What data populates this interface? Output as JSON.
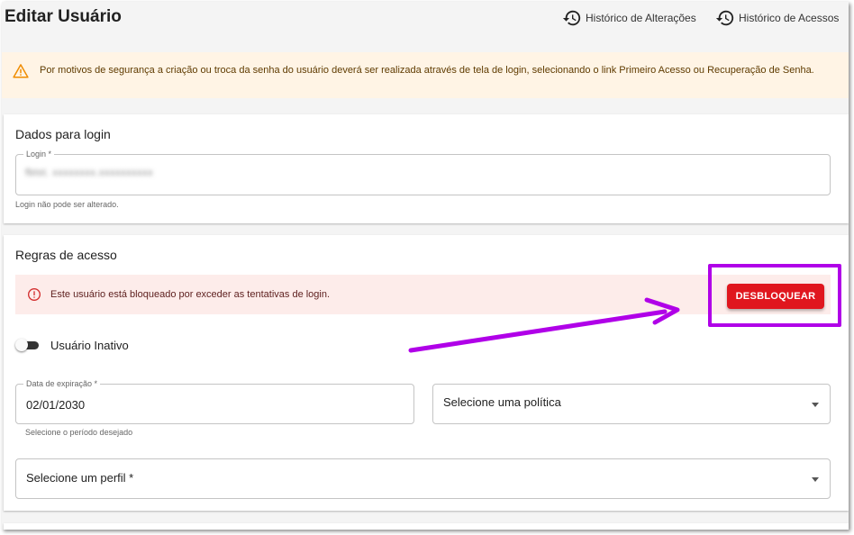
{
  "header": {
    "title": "Editar Usuário",
    "history_changes_label": "Histórico de Alterações",
    "history_access_label": "Histórico de Acessos"
  },
  "warning": {
    "text": "Por motivos de segurança a criação ou troca da senha do usuário deverá ser realizada através de tela de login, selecionando o link Primeiro Acesso ou Recuperação de Senha."
  },
  "login_section": {
    "title": "Dados para login",
    "login_label": "Login *",
    "login_value": "fbtst. xxxxxxxx.xxxxxxxxxx",
    "helper": "Login não pode ser alterado."
  },
  "access_rules": {
    "title": "Regras de acesso",
    "blocked_message": "Este usuário está bloqueado por exceder as tentativas de login.",
    "unlock_button": "DESBLOQUEAR",
    "inactive_toggle_label": "Usuário Inativo",
    "inactive": false,
    "expiration_label": "Data de expiração *",
    "expiration_value": "02/01/2030",
    "expiration_helper": "Selecione o período desejado",
    "policy_placeholder": "Selecione uma política",
    "profile_placeholder": "Selecione um perfil *"
  },
  "colors": {
    "danger_button": "#e0161e",
    "annotation": "#b000e8",
    "warning_bg": "#fff4e5",
    "error_bg": "#fdecea"
  },
  "icons": [
    "history-icon",
    "warning-icon",
    "error-icon",
    "dropdown-arrow-icon"
  ]
}
